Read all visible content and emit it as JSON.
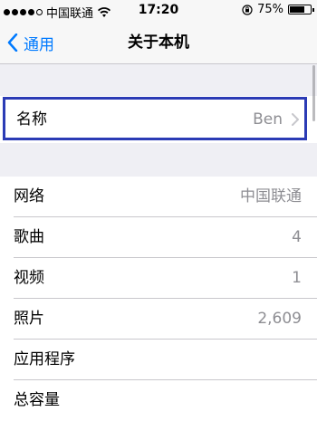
{
  "status_bar": {
    "carrier": "中国联通",
    "time": "17:20",
    "battery": "75%",
    "battery_level": 0.75,
    "signal_bars": 4,
    "icons": [
      "signal-dots-icon",
      "wifi-icon",
      "orientation-lock-icon",
      "battery-icon"
    ]
  },
  "nav": {
    "back_label": "通用",
    "title": "关于本机"
  },
  "name_row": {
    "label": "名称",
    "value": "Ben"
  },
  "rows": [
    {
      "label": "网络",
      "value": "中国联通"
    },
    {
      "label": "歌曲",
      "value": "4"
    },
    {
      "label": "视频",
      "value": "1"
    },
    {
      "label": "照片",
      "value": "2,609"
    },
    {
      "label": "应用程序",
      "value": ""
    },
    {
      "label": "总容量",
      "value": ""
    }
  ],
  "colors": {
    "accent": "#007aff",
    "highlight": "#2b3bb5",
    "secondary_text": "#8e8e93",
    "background": "#efeff4"
  }
}
